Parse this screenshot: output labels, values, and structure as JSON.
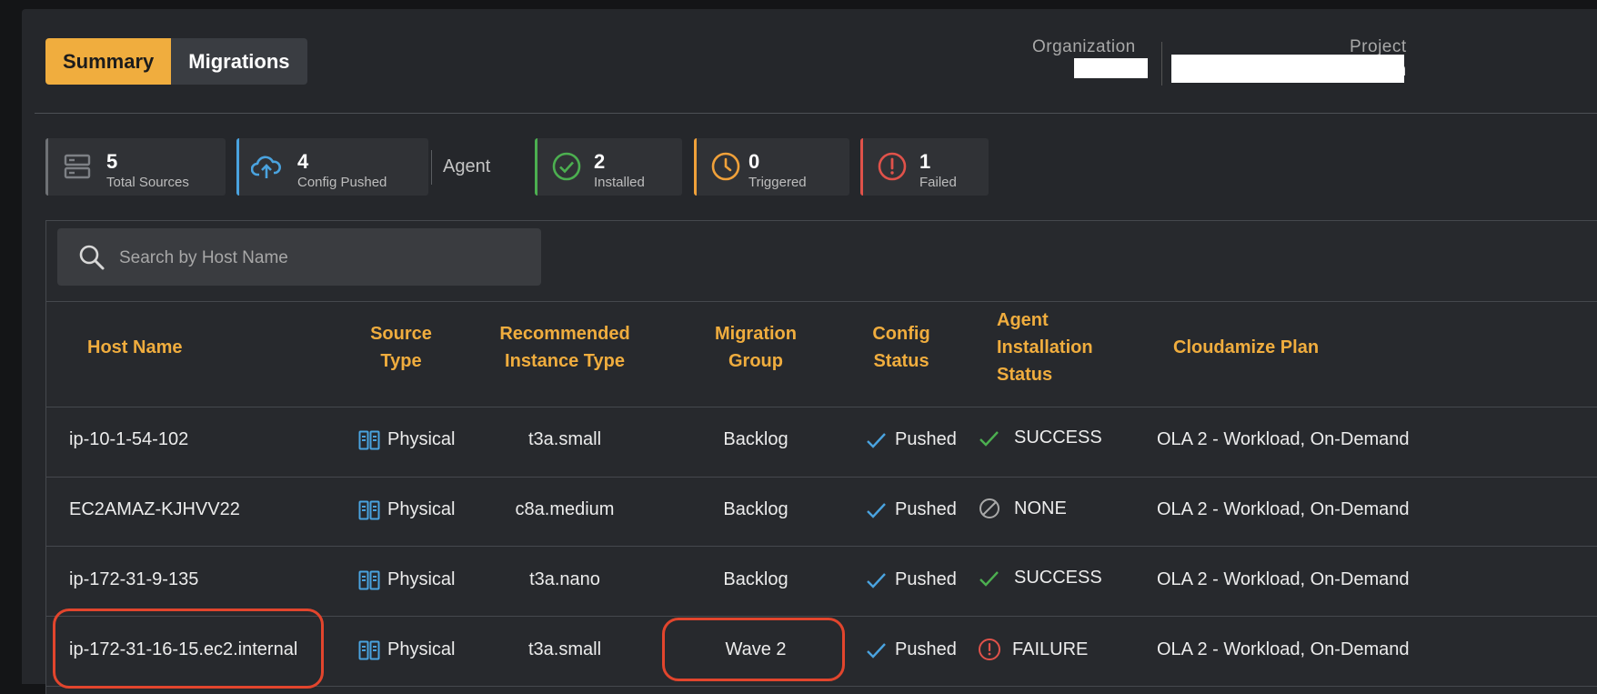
{
  "tabs": [
    {
      "label": "Summary",
      "active": true
    },
    {
      "label": "Migrations",
      "active": false
    }
  ],
  "header": {
    "organization_label": "Organization",
    "project_label": "Project",
    "project_trailing_char": "n"
  },
  "stats": {
    "total_sources": {
      "value": "5",
      "label": "Total Sources",
      "icon": "server-icon"
    },
    "config_pushed": {
      "value": "4",
      "label": "Config Pushed",
      "icon": "cloud-upload-icon"
    },
    "agent_label": "Agent",
    "installed": {
      "value": "2",
      "label": "Installed",
      "icon": "check-circle-icon"
    },
    "triggered": {
      "value": "0",
      "label": "Triggered",
      "icon": "clock-icon"
    },
    "failed": {
      "value": "1",
      "label": "Failed",
      "icon": "alert-circle-icon"
    }
  },
  "search": {
    "placeholder": "Search by Host Name"
  },
  "table": {
    "columns": {
      "host": "Host Name",
      "source_1": "Source",
      "source_2": "Type",
      "rec_1": "Recommended",
      "rec_2": "Instance Type",
      "mg_1": "Migration",
      "mg_2": "Group",
      "cfg_1": "Config",
      "cfg_2": "Status",
      "agent_1": "Agent",
      "agent_2": "Installation",
      "agent_3": "Status",
      "plan": "Cloudamize Plan"
    },
    "rows": [
      {
        "host": "ip-10-1-54-102",
        "source": "Physical",
        "instance": "t3a.small",
        "group": "Backlog",
        "config": "Pushed",
        "agent": "SUCCESS",
        "agent_icon": "check-icon",
        "plan": "OLA 2 - Workload, On-Demand"
      },
      {
        "host": "EC2AMAZ-KJHVV22",
        "source": "Physical",
        "instance": "c8a.medium",
        "group": "Backlog",
        "config": "Pushed",
        "agent": "NONE",
        "agent_icon": "ban-icon",
        "plan": "OLA 2 - Workload, On-Demand"
      },
      {
        "host": "ip-172-31-9-135",
        "source": "Physical",
        "instance": "t3a.nano",
        "group": "Backlog",
        "config": "Pushed",
        "agent": "SUCCESS",
        "agent_icon": "check-icon",
        "plan": "OLA 2 - Workload, On-Demand"
      },
      {
        "host": "ip-172-31-16-15.ec2.internal",
        "source": "Physical",
        "instance": "t3a.small",
        "group": "Wave 2",
        "config": "Pushed",
        "agent": "FAILURE",
        "agent_icon": "alert-circle-icon",
        "plan": "OLA 2 - Workload, On-Demand"
      }
    ]
  },
  "colors": {
    "accent": "#f0ad3e",
    "panel": "#25272b",
    "success": "#4caf50",
    "info": "#4aa3df",
    "warning": "#f0a13a",
    "danger": "#e0524a",
    "highlight": "#e2452d"
  }
}
